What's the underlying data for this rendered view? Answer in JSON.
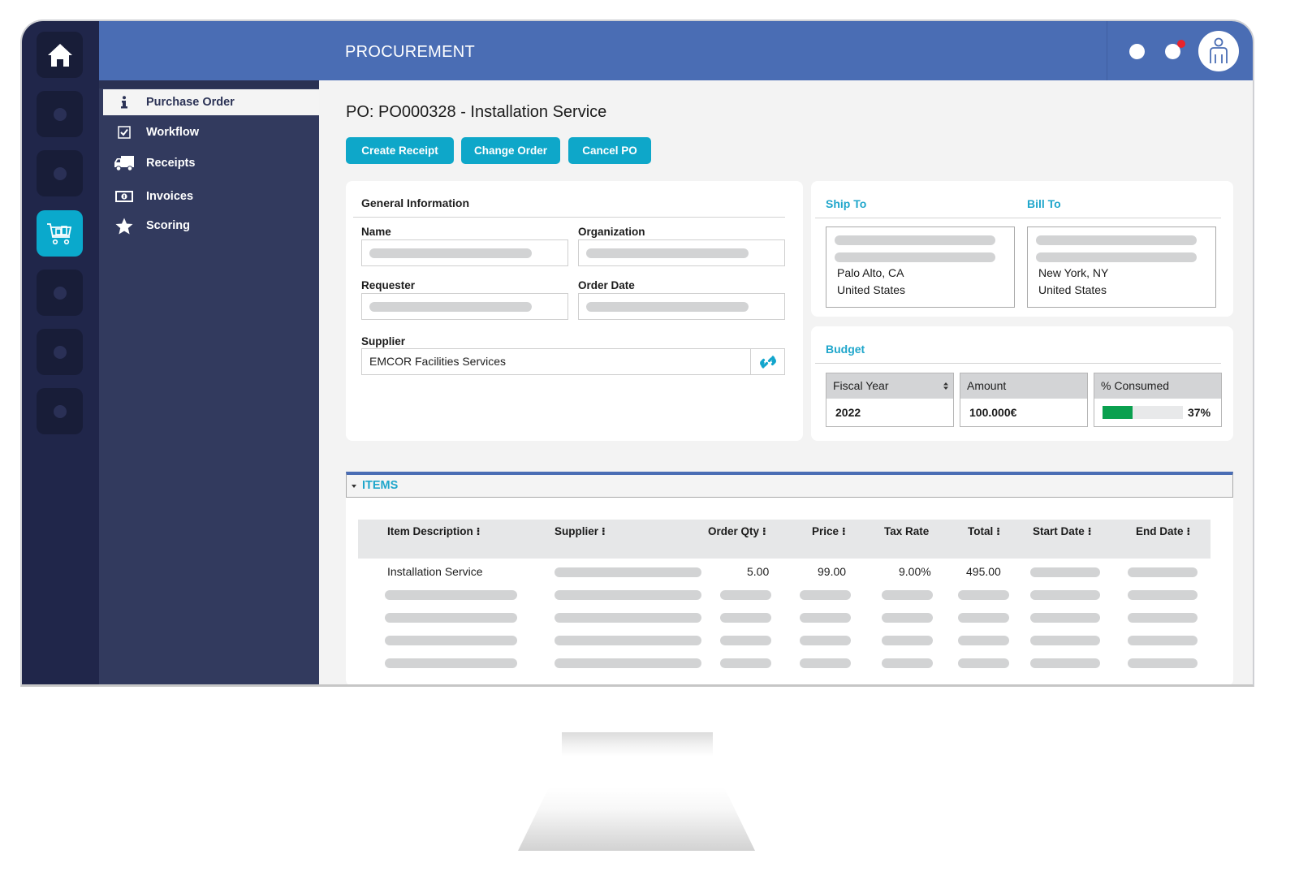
{
  "app": {
    "header_title": "PROCUREMENT",
    "notification_badge_color": "#e8232b",
    "accent_color": "#0ea7c9",
    "header_color": "#4a6db4"
  },
  "rail": {
    "items": [
      {
        "icon": "home-icon",
        "active": false
      },
      {
        "icon": "placeholder-icon",
        "active": false
      },
      {
        "icon": "placeholder-icon",
        "active": false
      },
      {
        "icon": "shopping-cart-icon",
        "active": true
      },
      {
        "icon": "placeholder-icon",
        "active": false
      },
      {
        "icon": "placeholder-icon",
        "active": false
      },
      {
        "icon": "placeholder-icon",
        "active": false
      }
    ]
  },
  "subnav": {
    "items": [
      {
        "label": "Purchase Order",
        "icon": "info-icon",
        "active": true
      },
      {
        "label": "Workflow",
        "icon": "checkbox-icon",
        "active": false
      },
      {
        "label": "Receipts",
        "icon": "truck-icon",
        "active": false
      },
      {
        "label": "Invoices",
        "icon": "money-bill-icon",
        "active": false
      },
      {
        "label": "Scoring",
        "icon": "star-icon",
        "active": false
      }
    ]
  },
  "page": {
    "title": "PO: PO000328 - Installation Service",
    "buttons": {
      "create_receipt": "Create Receipt",
      "change_order": "Change Order",
      "cancel_po": "Cancel PO"
    }
  },
  "general_info": {
    "title": "General Information",
    "name_label": "Name",
    "organization_label": "Organization",
    "requester_label": "Requester",
    "order_date_label": "Order Date",
    "supplier_label": "Supplier",
    "supplier_value": "EMCOR Facilities Services"
  },
  "addresses": {
    "ship_to": {
      "title": "Ship To",
      "city": "Palo Alto, CA",
      "country": "United States"
    },
    "bill_to": {
      "title": "Bill To",
      "city": "New York, NY",
      "country": "United States"
    }
  },
  "budget": {
    "title": "Budget",
    "fiscal_year_label": "Fiscal Year",
    "fiscal_year_value": "2022",
    "amount_label": "Amount",
    "amount_value": "100.000€",
    "consumed_label": "% Consumed",
    "consumed_percent": 37,
    "consumed_text": "37%",
    "consumed_bar_color": "#0aa04f"
  },
  "items": {
    "section_title": "ITEMS",
    "columns": [
      {
        "label": "Item Description",
        "sortable": true
      },
      {
        "label": "Supplier",
        "sortable": true
      },
      {
        "label": "Order Qty",
        "sortable": true
      },
      {
        "label": "Price",
        "sortable": true
      },
      {
        "label": "Tax Rate",
        "sortable": false
      },
      {
        "label": "Total",
        "sortable": true
      },
      {
        "label": "Start Date",
        "sortable": true
      },
      {
        "label": "End Date",
        "sortable": true
      }
    ],
    "rows": [
      {
        "description": "Installation Service",
        "order_qty": "5.00",
        "price": "99.00",
        "tax_rate": "9.00%",
        "total": "495.00"
      }
    ],
    "placeholder_row_count": 4
  }
}
